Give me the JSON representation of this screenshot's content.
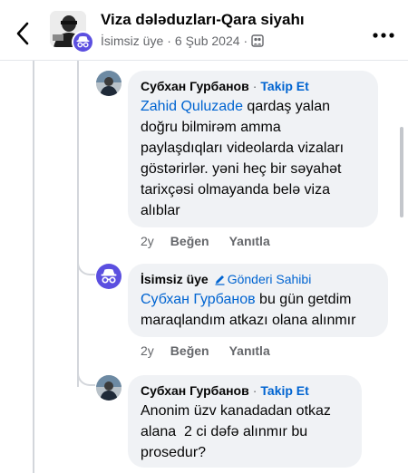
{
  "header": {
    "title": "Viza dələduzları-Qara siyahı",
    "subtitle_author": "İsimsiz üye",
    "subtitle_date": "6 Şub 2024",
    "separator": "·"
  },
  "comments": [
    {
      "author": "Субхан Гурбанов",
      "follow_label": "Takip Et",
      "mention": "Zahid Quluzade",
      "text_line1": " qardaş yalan",
      "text_rest": "doğru bilmirəm amma paylaşdıqları videolarda vizaları göstərirlər. yəni heç bir səyahət tarixçəsi olmayanda belə viza alıblar",
      "time": "2y",
      "like_label": "Beğen",
      "reply_label": "Yanıtla"
    },
    {
      "author": "İsimsiz üye",
      "badge_label": "Gönderi Sahibi",
      "mention": "Субхан Гурбанов",
      "text_line1": " bu gün getdim",
      "text_rest": "maraqlandım atkazı olana alınmır",
      "time": "2y",
      "like_label": "Beğen",
      "reply_label": "Yanıtla"
    },
    {
      "author": "Субхан Гурбанов",
      "follow_label": "Takip Et",
      "text": "Anonim üzv kanadadan otkaz alana  2 ci dəfə alınmır bu prosedur?"
    }
  ],
  "colors": {
    "link": "#0064d1",
    "bubble": "#f0f2f5",
    "anon_badge": "#5b4fe0",
    "muted": "#65676b"
  }
}
